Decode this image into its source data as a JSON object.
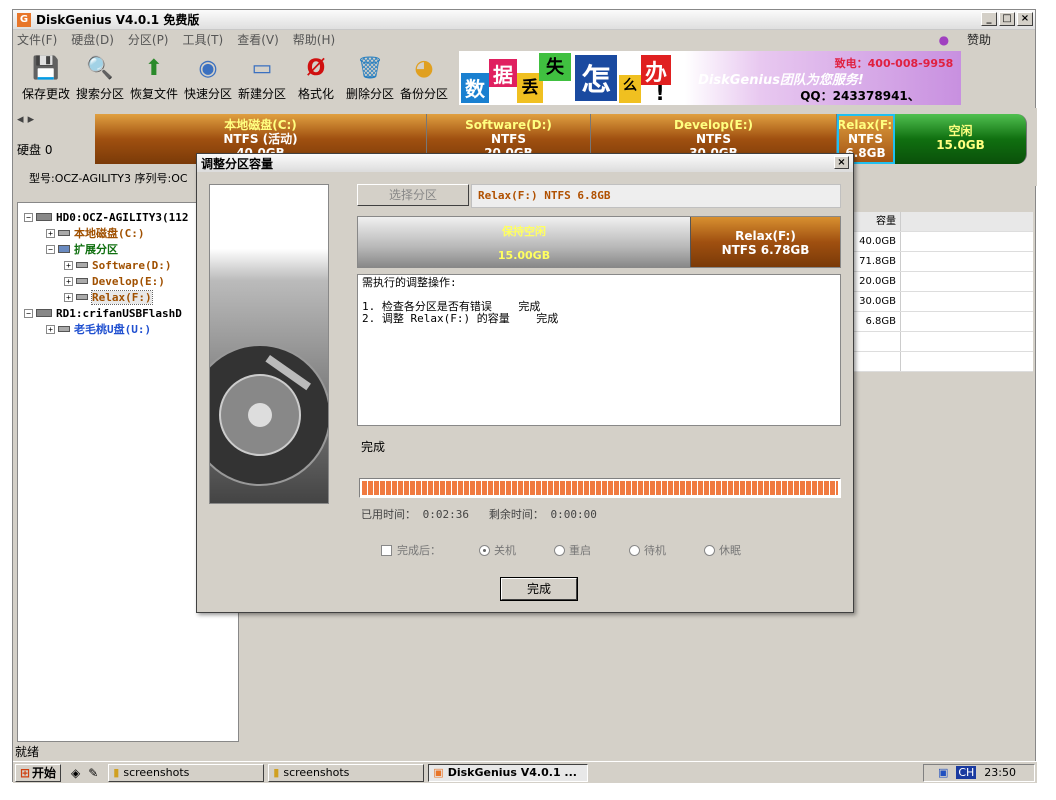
{
  "app": {
    "title": "DiskGenius V4.0.1 免费版",
    "icon": "G"
  },
  "menu": {
    "items": [
      "文件(F)",
      "硬盘(D)",
      "分区(P)",
      "工具(T)",
      "查看(V)",
      "帮助(H)"
    ],
    "sponsor": "赞助"
  },
  "toolbar": {
    "items": [
      "保存更改",
      "搜索分区",
      "恢复文件",
      "快速分区",
      "新建分区",
      "格式化",
      "删除分区",
      "备份分区"
    ]
  },
  "banner": {
    "chars": [
      "数",
      "据",
      "丢",
      "失",
      "怎",
      "么",
      "办",
      "!"
    ],
    "brand": "DiskGenius团队为您服务!",
    "phone": "致电：400-008-9958",
    "qq": "QQ：243378941、1300899558"
  },
  "diskbar": {
    "disk_label": "硬盘 0",
    "model_line": "型号:OCZ-AGILITY3  序列号:OC",
    "partitions": [
      {
        "name": "本地磁盘(C:)",
        "fs": "NTFS (活动)",
        "size": "40.0GB"
      },
      {
        "name": "Software(D:)",
        "fs": "NTFS",
        "size": "20.0GB"
      },
      {
        "name": "Develop(E:)",
        "fs": "NTFS",
        "size": "30.0GB"
      },
      {
        "name": "Relax(F:)",
        "fs": "NTFS",
        "size": "6.8GB"
      },
      {
        "name": "空闲",
        "fs": "15.0GB",
        "size": ""
      }
    ]
  },
  "tree": {
    "disk0": "HD0:OCZ-AGILITY3(112",
    "c": "本地磁盘(C:)",
    "ext": "扩展分区",
    "d": "Software(D:)",
    "e": "Develop(E:)",
    "f": "Relax(F:)",
    "disk1": "RD1:crifanUSBFlashD",
    "usb": "老毛桃U盘(U:)"
  },
  "capacity": {
    "header": "容量",
    "values": [
      "40.0GB",
      "71.8GB",
      "20.0GB",
      "30.0GB",
      "6.8GB"
    ]
  },
  "dialog": {
    "title": "调整分区容量",
    "select_btn": "选择分区",
    "selected": "Relax(F:) NTFS 6.8GB",
    "left_label": "保持空闲",
    "left_size": "15.00GB",
    "right_label": "Relax(F:)",
    "right_size": "NTFS 6.78GB",
    "log": "需执行的调整操作:\n\n1. 检查各分区是否有错误    完成\n2. 调整 Relax(F:) 的容量    完成",
    "status": "完成",
    "progress": 1.0,
    "elapsed_label": "已用时间：",
    "elapsed": "0:02:36",
    "remain_label": "剩余时间：",
    "remain": "0:00:00",
    "after_label": "完成后：",
    "opt1": "关机",
    "opt2": "重启",
    "opt3": "待机",
    "opt4": "休眠",
    "ok": "完成"
  },
  "status_text": "就绪",
  "taskbar": {
    "start": "开始",
    "t1": "screenshots",
    "t2": "screenshots",
    "t3": "DiskGenius V4.0.1 ...",
    "ime": "CH",
    "clock": "23:50"
  }
}
